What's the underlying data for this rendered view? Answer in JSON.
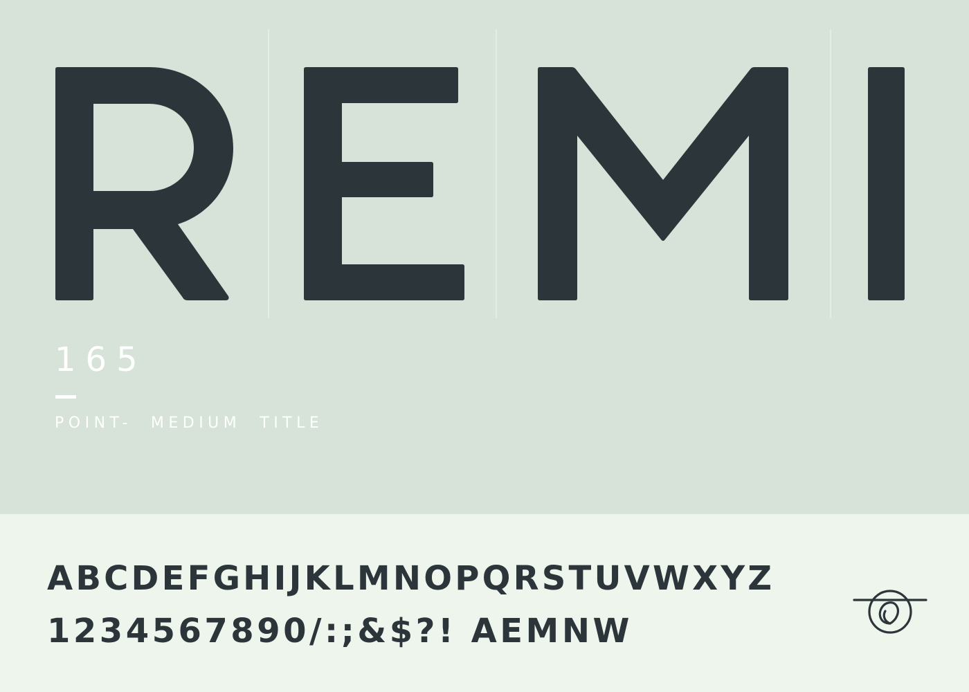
{
  "specimen": {
    "name": "REMI",
    "letters": [
      "R",
      "E",
      "M",
      "I"
    ],
    "point_size": "165",
    "caption": "POINT-  MEDIUM  TITLE"
  },
  "character_set": {
    "uppercase": "ABCDEFGHIJKLMNOPQRSTUVWXYZ",
    "digits_and_alternates": "1234567890/:;&$?! AEMNW"
  },
  "colors": {
    "ink": "#2c3539",
    "top_background": "#d7e3d8",
    "bottom_background": "#eef5ec",
    "accent": "#ffffff"
  },
  "icons": {
    "brand": "loop-knot-icon"
  }
}
